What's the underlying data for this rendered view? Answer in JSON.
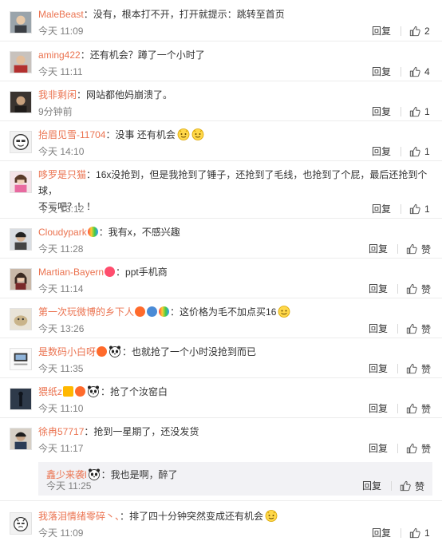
{
  "labels": {
    "reply": "回复",
    "like": "赞"
  },
  "comments": [
    {
      "user": "MaleBeast",
      "text": "：没有，根本打不开，打开就提示：跳转至首页",
      "time": "今天 11:09",
      "likes": "2"
    },
    {
      "user": "aming422",
      "text": "：还有机会？蹲了一个小时了",
      "time": "今天 11:11",
      "likes": "4"
    },
    {
      "user": "我非剩闲",
      "text": "：网站都他妈崩溃了。",
      "time": "9分钟前",
      "likes": "1"
    },
    {
      "user": "抬眉见雪-11704",
      "text": "：没事  还有机会",
      "time": "今天 14:10",
      "likes": "1"
    },
    {
      "user": "哆罗是只猫",
      "text": "：16x没抢到，但是我抢到了锤子，还抢到了毛线，也抢到了个屁，最后还抢到个球，",
      "text2": "不亏吧？！！",
      "time": "今天 13:12",
      "likes": "1"
    },
    {
      "user": "Cloudypark",
      "text": "：我有x，不感兴趣",
      "time": "今天 11:28",
      "likes": "赞"
    },
    {
      "user": "Martian-Bayern",
      "text": "：ppt手机商",
      "time": "今天 11:14",
      "likes": "赞"
    },
    {
      "user": "第一次玩微博的乡下人",
      "text": "：这价格为毛不加点买16",
      "time": "今天 13:26",
      "likes": "赞"
    },
    {
      "user": "是数码小白呀",
      "text": "：也就抢了一个小时没抢到而已",
      "time": "今天 11:35",
      "likes": "赞"
    },
    {
      "user": "猥纸z",
      "text": "：抢了个汝窑白",
      "time": "今天 11:10",
      "likes": "赞"
    },
    {
      "user": "徐冉57717",
      "text": "：抢到一星期了，还没发货",
      "time": "今天 11:17",
      "likes": "赞"
    },
    {
      "user": "我落泪情绪零碎丶、",
      "text": "：排了四十分钟突然变成还有机会",
      "time": "今天 11:09",
      "likes": "1"
    }
  ],
  "reply_thread": {
    "user": "鑫少来袭l",
    "text": "：我也是啊，醉了",
    "time": "今天 11:25",
    "likes": "赞"
  },
  "icons": {
    "like": "thumbs-up-icon",
    "emoji": "smiling-face-emoji",
    "panda": "panda-emoji"
  },
  "colors": {
    "username": "#eb7350",
    "time": "#808080",
    "reply_bg": "#f2f2f5"
  }
}
